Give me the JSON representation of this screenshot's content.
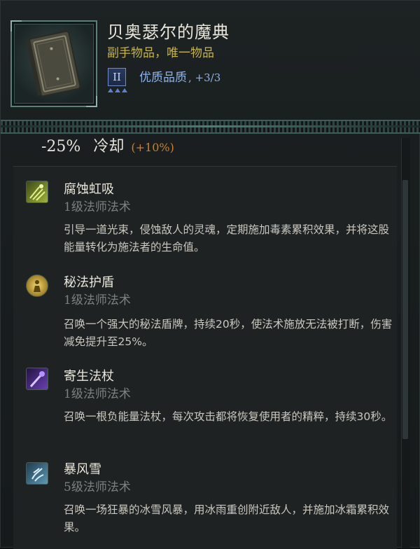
{
  "item": {
    "name": "贝奥瑟尔的魔典",
    "type": "副手物品，唯一物品",
    "tier": "II",
    "quality_label": "优质品质",
    "quality_value": ", +3/3",
    "icon": "book-icon"
  },
  "stat": {
    "value": "-25%",
    "name": "冷却",
    "bonus": "(+10%)"
  },
  "spells": [
    {
      "name": "腐蚀虹吸",
      "level": "1级法师法术",
      "desc": "引导一道光束，侵蚀敌人的灵魂，定期施加毒素累积效果，并将这股能量转化为施法者的生命值。",
      "icon": "corrosive-siphon-icon",
      "color": "#9fb43c"
    },
    {
      "name": "秘法护盾",
      "level": "1级法师法术",
      "desc": "召唤一个强大的秘法盾牌，持续20秒，使法术施放无法被打断，伤害减免提升至25%。",
      "icon": "arcane-shield-icon",
      "color": "#d6b13a"
    },
    {
      "name": "寄生法杖",
      "level": "1级法师法术",
      "desc": "召唤一根负能量法杖，每次攻击都将恢复使用者的精粹，持续30秒。",
      "icon": "parasitic-staff-icon",
      "color": "#6b3fb4"
    },
    {
      "name": "暴风雪",
      "level": "5级法师法术",
      "desc": "召唤一场狂暴的冰雪风暴，用冰雨重创附近敌人，并施加冰霜累积效果。",
      "icon": "blizzard-icon",
      "color": "#5f98b5"
    }
  ]
}
